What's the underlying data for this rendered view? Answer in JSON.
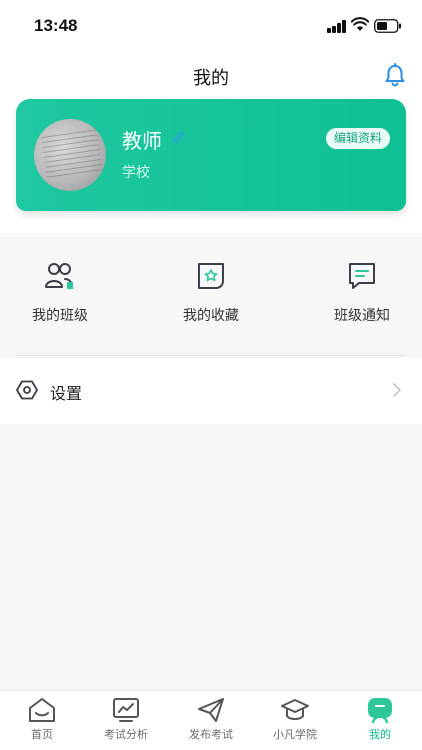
{
  "status_bar": {
    "time": "13:48"
  },
  "header": {
    "title": "我的"
  },
  "profile": {
    "name": "教师",
    "school": "学校",
    "edit_label": "编辑资料"
  },
  "quick_actions": [
    {
      "label": "我的班级",
      "icon": "class-users-icon"
    },
    {
      "label": "我的收藏",
      "icon": "favorites-star-icon"
    },
    {
      "label": "班级通知",
      "icon": "notice-chat-icon"
    }
  ],
  "settings": {
    "label": "设置",
    "icon": "settings-hexagon-icon"
  },
  "tab_bar": {
    "active_index": 4,
    "tabs": [
      {
        "label": "首页",
        "icon": "home-icon"
      },
      {
        "label": "考试分析",
        "icon": "analysis-icon"
      },
      {
        "label": "发布考试",
        "icon": "paper-plane-icon"
      },
      {
        "label": "小凡学院",
        "icon": "graduation-cap-icon"
      },
      {
        "label": "我的",
        "icon": "profile-face-icon"
      }
    ]
  },
  "colors": {
    "accent": "#12b88b",
    "card_start": "#1fc8a0",
    "card_end": "#0fc093",
    "bell": "#2f8fe0"
  }
}
